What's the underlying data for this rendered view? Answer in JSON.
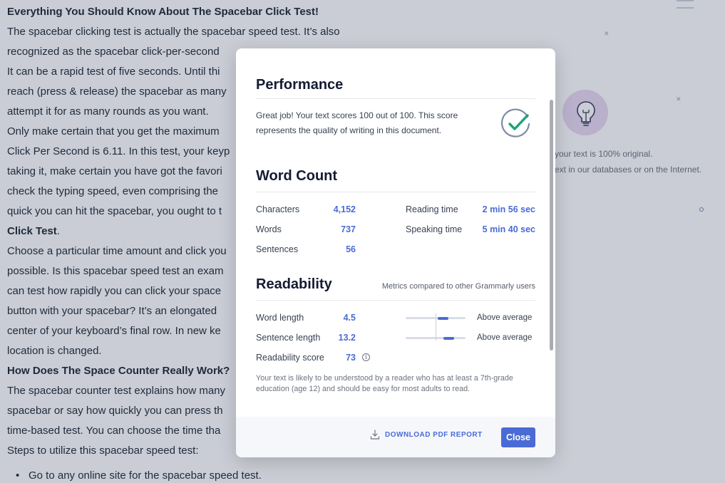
{
  "document": {
    "lines": [
      {
        "text": "Everything You Should Know About The Spacebar Click Test!",
        "bold": true
      },
      {
        "text": "The spacebar clicking test is actually the spacebar speed test. It’s also",
        "bold": false
      },
      {
        "text": "recognized as the spacebar click-per-second",
        "bold": false
      },
      {
        "text": "It can be a rapid test of five seconds. Until thi",
        "bold": false
      },
      {
        "text": "reach (press & release) the spacebar as many",
        "bold": false
      },
      {
        "text": "attempt it for as many rounds as you want.",
        "bold": false
      },
      {
        "text": "Only make certain that you get the maximum",
        "bold": false
      },
      {
        "text": "Click Per Second is 6.11. In this test, your keyp",
        "bold": false
      },
      {
        "text": "taking it, make certain you have got the favori",
        "bold": false
      },
      {
        "text": "check the typing speed, even comprising the",
        "bold": false
      },
      {
        "text": "quick you can hit the spacebar, you ought to t",
        "bold": false
      },
      {
        "text": "Click Test",
        "bold": true,
        "suffix": "."
      },
      {
        "text": "Choose a particular time amount and click you",
        "bold": false
      },
      {
        "text": "possible. Is this spacebar speed test an exam",
        "bold": false
      },
      {
        "text": "can test how rapidly you can click your space",
        "bold": false
      },
      {
        "text": "button with your spacebar? It’s an elongated",
        "bold": false
      },
      {
        "text": "center of your keyboard’s final row. In new ke",
        "bold": false
      },
      {
        "text": "location is changed.",
        "bold": false
      },
      {
        "text": "How Does The Space Counter Really Work?",
        "bold": true
      },
      {
        "text": "The spacebar counter test explains how many",
        "bold": false
      },
      {
        "text": "spacebar or say how quickly you can press th",
        "bold": false
      },
      {
        "text": "time-based test. You can choose the time tha",
        "bold": false
      },
      {
        "text": "Steps to utilize this spacebar speed test:",
        "bold": false
      }
    ],
    "bullets": [
      "Go to any online site for the spacebar speed test."
    ]
  },
  "side_panel": {
    "line1": "your text is 100% original.",
    "line2": "ext in our databases or on the Internet.",
    "bulb_icon": "lightbulb-icon"
  },
  "modal": {
    "performance": {
      "title": "Performance",
      "text": "Great job! Your text scores 100 out of 100. This score represents the quality of writing in this document.",
      "icon": "checkmark-circle-icon",
      "accent": "#1aa37a"
    },
    "word_count": {
      "title": "Word Count",
      "left": [
        {
          "label": "Characters",
          "value": "4,152"
        },
        {
          "label": "Words",
          "value": "737"
        },
        {
          "label": "Sentences",
          "value": "56"
        }
      ],
      "right": [
        {
          "label": "Reading time",
          "value": "2 min 56 sec"
        },
        {
          "label": "Speaking time",
          "value": "5 min 40 sec"
        }
      ]
    },
    "readability": {
      "title": "Readability",
      "metrics_note": "Metrics compared to other Grammarly users",
      "rows": [
        {
          "label": "Word length",
          "value": "4.5",
          "comparison": "Above average",
          "level": 0.63
        },
        {
          "label": "Sentence length",
          "value": "13.2",
          "comparison": "Above average",
          "level": 0.72
        },
        {
          "label": "Readability score",
          "value": "73"
        }
      ],
      "info_icon": "info-icon",
      "note": "Your text is likely to be understood by a reader who has at least a 7th-grade education (age 12) and should be easy for most adults to read."
    },
    "footer": {
      "download_label": "DOWNLOAD PDF REPORT",
      "download_icon": "download-icon",
      "close_label": "Close"
    },
    "accent_color": "#4a6bd6"
  }
}
